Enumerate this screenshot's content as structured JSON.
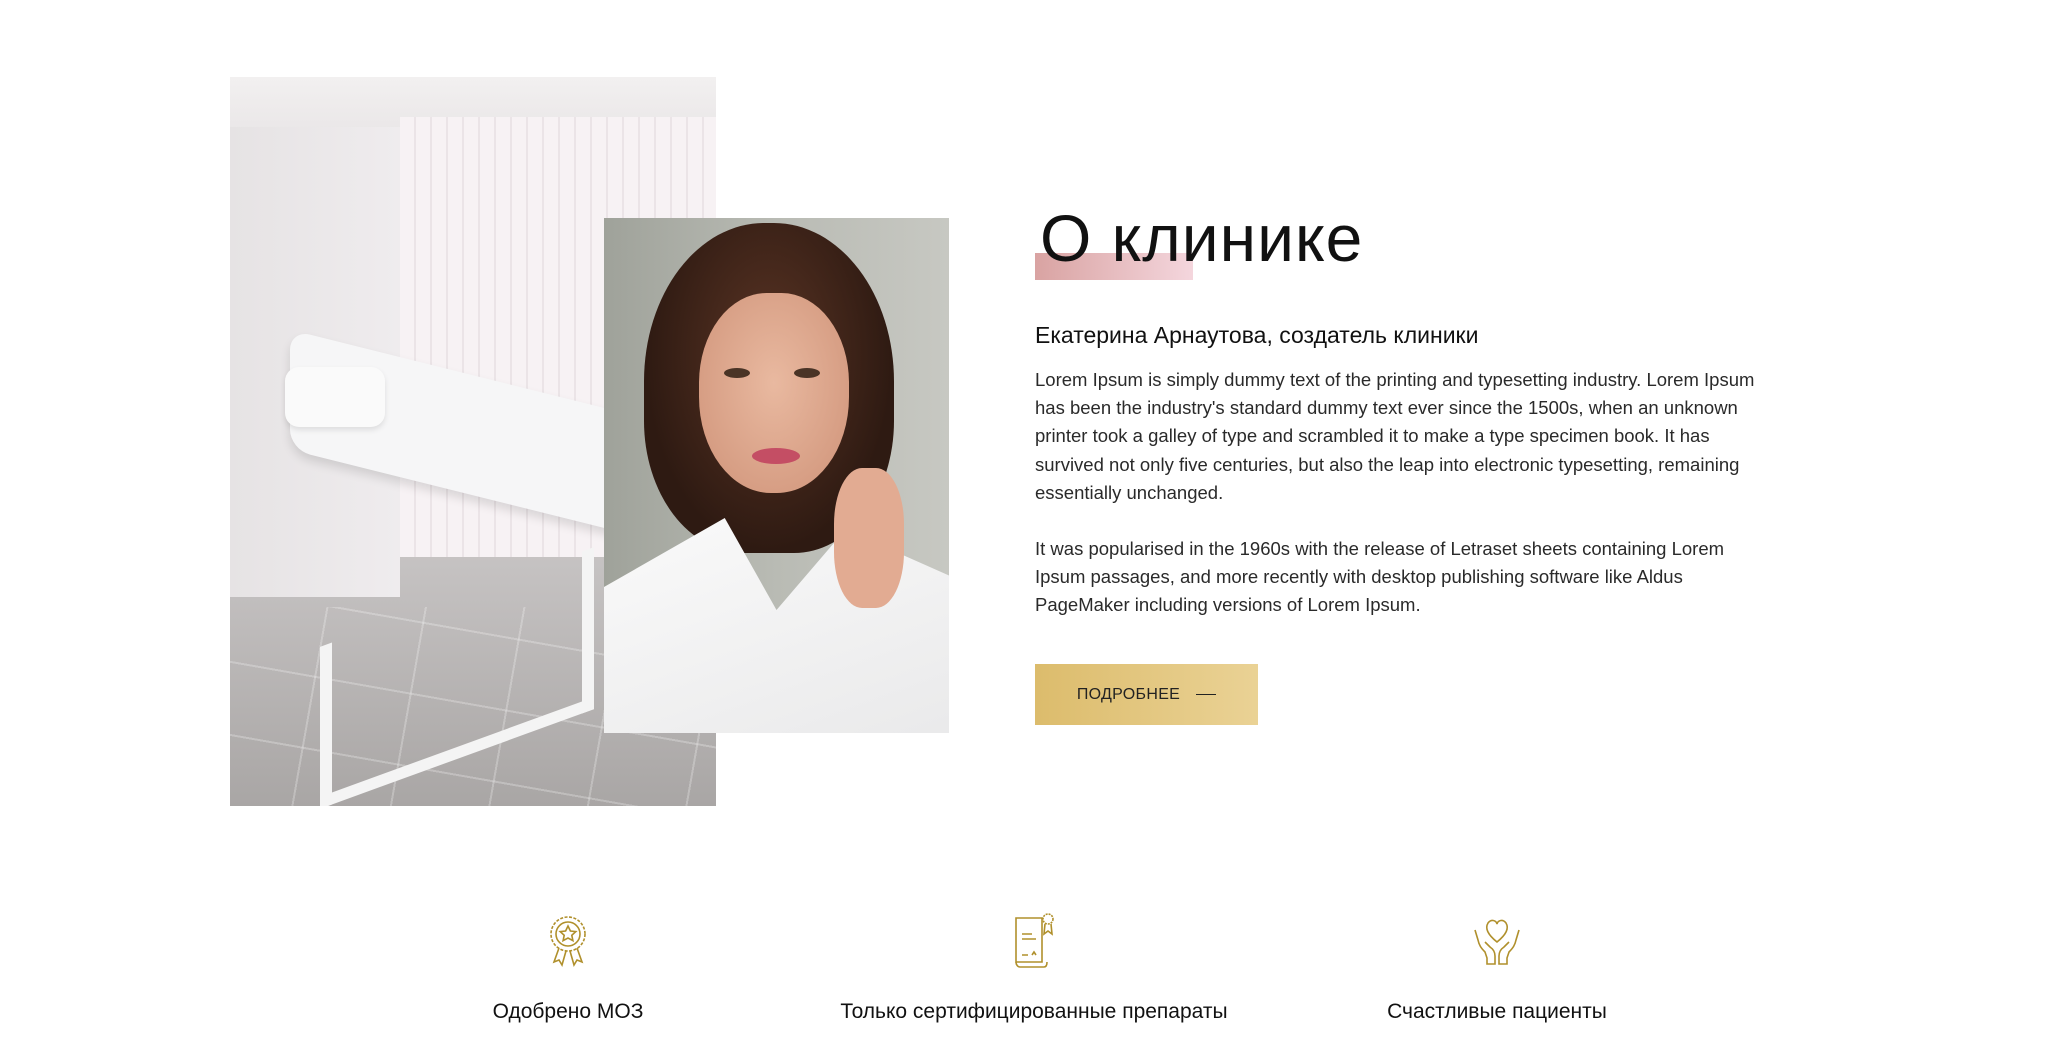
{
  "about": {
    "title": "О клинике",
    "founder_name": "Екатерина Арнаутова",
    "founder_role": ", создатель клиники",
    "paragraphs": [
      "Lorem Ipsum is simply dummy text of the printing and typesetting industry. Lorem Ipsum has been the industry's standard dummy text ever since the 1500s, when an unknown printer took a galley of type and scrambled it to make a type specimen book. It has survived not only five centuries, but also the leap into electronic typesetting, remaining essentially unchanged.",
      "It was popularised in the 1960s with the release of Letraset sheets containing Lorem Ipsum passages, and more recently with desktop publishing software like Aldus PageMaker including versions of Lorem Ipsum."
    ],
    "button_label": "ПОДРОБНЕЕ"
  },
  "features": [
    {
      "icon": "award-badge-icon",
      "label": "Одобрено МОЗ"
    },
    {
      "icon": "certificate-icon",
      "label": "Только сертифицированные препараты"
    },
    {
      "icon": "heart-hands-icon",
      "label": "Счастливые пациенты"
    }
  ],
  "colors": {
    "accent_gold": "#dcbc6c",
    "accent_pink": "#d9a3a2",
    "icon_gold": "#b0902c"
  }
}
